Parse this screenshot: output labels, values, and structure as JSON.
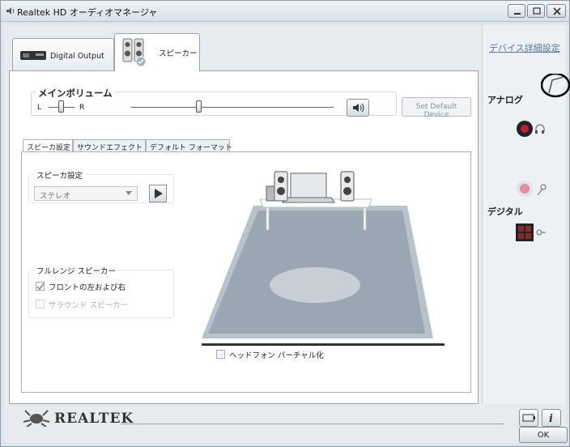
{
  "window": {
    "title": "Realtek HD オーディオマネージャ"
  },
  "device_tabs": [
    {
      "label": "Digital Output"
    },
    {
      "label": "スピーカー"
    }
  ],
  "volume": {
    "title": "メインボリューム",
    "left_label": "L",
    "right_label": "R",
    "set_default_label": "Set Default Device",
    "main_level": 0.33
  },
  "sub_tabs": [
    {
      "label": "スピーカ設定"
    },
    {
      "label": "サウンドエフェクト"
    },
    {
      "label": "デフォルト フォーマット"
    }
  ],
  "speaker_config": {
    "group_label": "スピーカ設定",
    "selected": "ステレオ"
  },
  "fullrange": {
    "group_label": "フルレンジ スピーカー",
    "items": [
      {
        "label": "フロントの左および右",
        "checked": true,
        "enabled": true
      },
      {
        "label": "サラウンド スピーカー",
        "checked": false,
        "enabled": false
      }
    ]
  },
  "headphone_virtualization": {
    "label": "ヘッドフォン バーチャル化",
    "checked": false
  },
  "right_panel": {
    "advanced_link": "デバイス詳細設定",
    "analog_label": "アナログ",
    "digital_label": "デジタル"
  },
  "brand": "REALTEK",
  "buttons": {
    "ok": "OK"
  },
  "colors": {
    "floor": "#9aa6b2",
    "jack_red": "#c0202c",
    "jack_pink": "#e88aa2"
  }
}
